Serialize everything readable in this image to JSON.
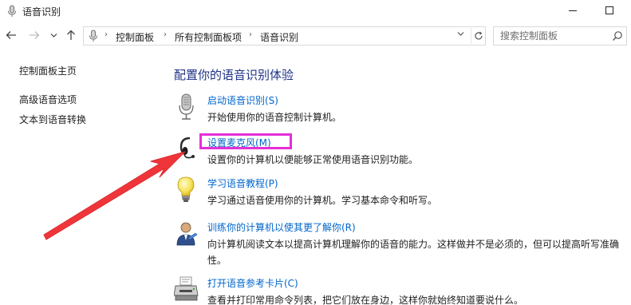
{
  "window": {
    "title": "语音识别",
    "minimize_glyph": "—",
    "maximize_glyph": "☐"
  },
  "address_bar": {
    "breadcrumbs": [
      "控制面板",
      "所有控制面板项",
      "语音识别"
    ],
    "separator": "›"
  },
  "search": {
    "placeholder": "搜索控制面板"
  },
  "left_pane": {
    "links": [
      "控制面板主页",
      "高级语音选项",
      "文本到语音转换"
    ]
  },
  "main": {
    "title": "配置你的语音识别体验",
    "tasks": [
      {
        "icon": "microphone-icon",
        "link": "启动语音识别(S)",
        "desc": "开始使用你的语音控制计算机。"
      },
      {
        "icon": "headset-icon",
        "link": "设置麦克风(M)",
        "desc": "设置你的计算机以便能够正常使用语音识别功能。"
      },
      {
        "icon": "lightbulb-icon",
        "link": "学习语音教程(P)",
        "desc": "学习通过语音使用你的计算机。学习基本命令和听写。"
      },
      {
        "icon": "user-training-icon",
        "link": "训练你的计算机以使其更了解你(R)",
        "desc": "向计算机阅读文本以提高计算机理解你的语音的能力。这样做并不是必须的，但可以提高听写准确性。"
      },
      {
        "icon": "printer-icon",
        "link": "打开语音参考卡片(C)",
        "desc": "查看并打印常用命令列表，把它们放在身边，这样你就始终知道要说什么。"
      }
    ]
  },
  "annotations": {
    "highlight_color": "#e62fd7",
    "arrow_color": "#f0353a"
  },
  "colors": {
    "link": "#0066cc",
    "heading": "#1e3287"
  }
}
